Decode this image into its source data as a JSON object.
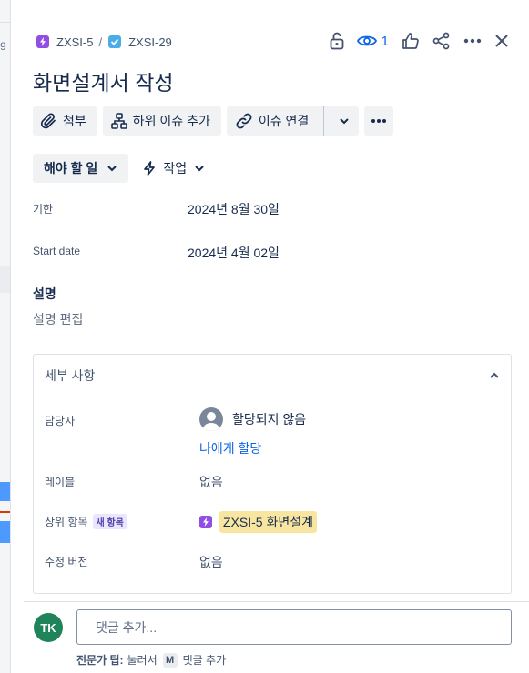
{
  "left_strip": {
    "fragment": "9"
  },
  "breadcrumb": {
    "parent": {
      "key": "ZXSI-5",
      "icon": "epic-icon"
    },
    "separator": "/",
    "current": {
      "key": "ZXSI-29",
      "icon": "task-checkbox-icon"
    }
  },
  "header": {
    "watch_count": "1",
    "icons": [
      "lock-open-icon",
      "eye-icon",
      "thumbs-up-icon",
      "share-icon",
      "more-icon",
      "close-icon"
    ]
  },
  "issue": {
    "title": "화면설계서 작성"
  },
  "toolbar": {
    "attach": "첨부",
    "add_child": "하위 이슈 추가",
    "link_issue": "이슈 연결"
  },
  "status": {
    "label": "해야 할 일",
    "work": "작업"
  },
  "fields": {
    "due_label": "기한",
    "due_value": "2024년 8월 30일",
    "start_label": "Start date",
    "start_value": "2024년 4월 02일"
  },
  "description": {
    "label": "설명",
    "edit": "설명 편집"
  },
  "details": {
    "title": "세부 사항",
    "assignee_label": "담당자",
    "assignee_value": "할당되지 않음",
    "assign_me": "나에게 할당",
    "labels_label": "레이블",
    "labels_value": "없음",
    "parent_label": "상위 항목",
    "parent_badge": "새 항목",
    "parent_value": "ZXSI-5 화면설계",
    "fix_label": "수정 버전",
    "fix_value": "없음"
  },
  "comment": {
    "avatar": "TK",
    "placeholder": "댓글 추가...",
    "tip_bold": "전문가 팁:",
    "tip_pre": "눌러서",
    "tip_key": "M",
    "tip_post": "댓글 추가"
  },
  "colors": {
    "accent": "#0c66e4",
    "epic": "#904ee2",
    "task": "#4bade8",
    "avatar": "#1f845a",
    "parent_highlight": "#f8e6a0"
  }
}
